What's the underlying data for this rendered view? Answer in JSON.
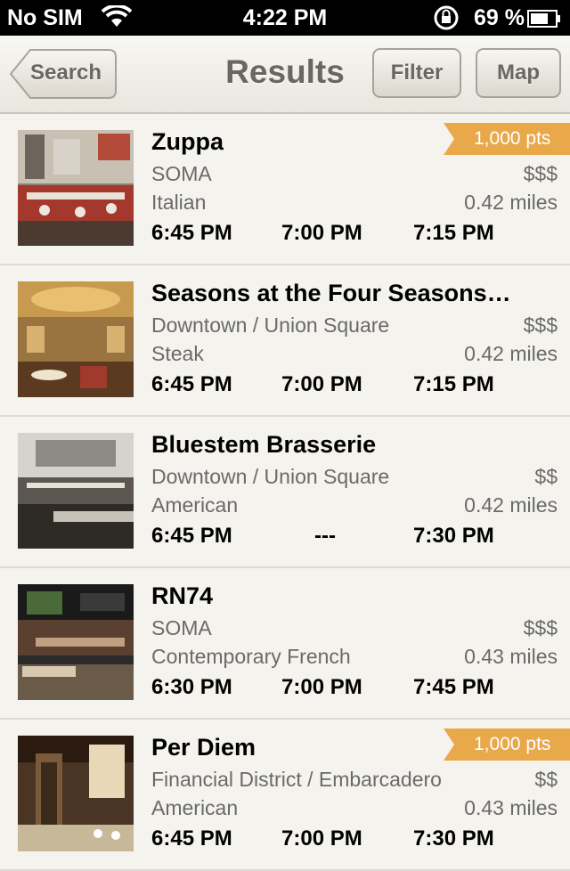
{
  "status_bar": {
    "carrier": "No SIM",
    "time": "4:22 PM",
    "battery_pct": "69 %"
  },
  "nav": {
    "back_label": "Search",
    "title": "Results",
    "filter_label": "Filter",
    "map_label": "Map"
  },
  "colors": {
    "background": "#f5f3ee",
    "badge": "#e9a94a",
    "nav_text": "#6b665e"
  },
  "restaurants": [
    {
      "name": "Zuppa",
      "neighborhood": "SOMA",
      "price": "$$$",
      "cuisine": "Italian",
      "distance": "0.42 miles",
      "times": [
        "6:45 PM",
        "7:00 PM",
        "7:15 PM"
      ],
      "badge": "1,000 pts"
    },
    {
      "name": "Seasons at the Four Seasons…",
      "neighborhood": "Downtown / Union Square",
      "price": "$$$",
      "cuisine": "Steak",
      "distance": "0.42 miles",
      "times": [
        "6:45 PM",
        "7:00 PM",
        "7:15 PM"
      ]
    },
    {
      "name": "Bluestem Brasserie",
      "neighborhood": "Downtown / Union Square",
      "price": "$$",
      "cuisine": "American",
      "distance": "0.42 miles",
      "times": [
        "6:45 PM",
        "---",
        "7:30 PM"
      ]
    },
    {
      "name": "RN74",
      "neighborhood": "SOMA",
      "price": "$$$",
      "cuisine": "Contemporary French",
      "distance": "0.43 miles",
      "times": [
        "6:30 PM",
        "7:00 PM",
        "7:45 PM"
      ]
    },
    {
      "name": "Per Diem",
      "neighborhood": "Financial District / Embarcadero",
      "price": "$$",
      "cuisine": "American",
      "distance": "0.43 miles",
      "times": [
        "6:45 PM",
        "7:00 PM",
        "7:30 PM"
      ],
      "badge": "1,000 pts"
    }
  ]
}
